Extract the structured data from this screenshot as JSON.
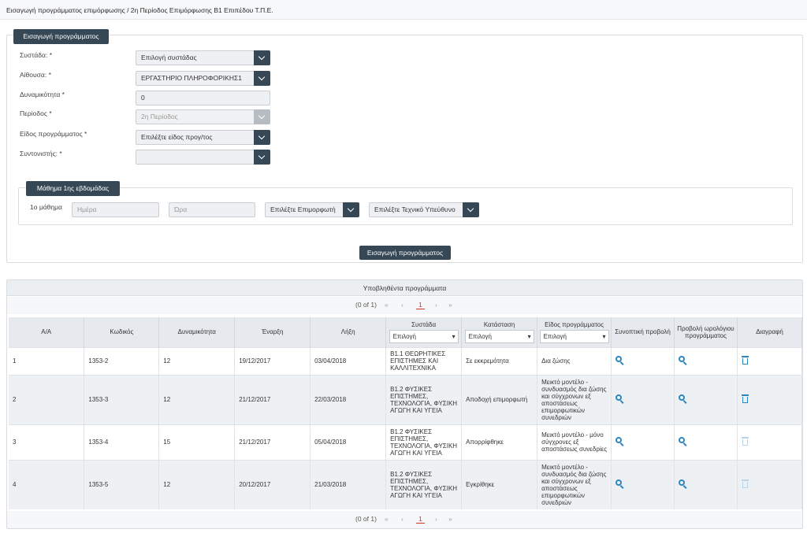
{
  "header": {
    "title": "Εισαγωγή προγράμματος επιμόρφωσης / 2η Περίοδος Επιμόρφωσης Β1 Επιπέδου Τ.Π.Ε."
  },
  "form": {
    "legend": "Εισαγωγή προγράμματος",
    "fields": {
      "systada": {
        "label": "Συστάδα:",
        "value": "Επιλογή συστάδας"
      },
      "aithousa": {
        "label": "Αίθουσα:",
        "value": "ΕΡΓΑΣΤΗΡΙΟ ΠΛΗΡΟΦΟΡΙΚΗΣ1"
      },
      "capacity": {
        "label": "Δυναμικότητα",
        "value": "0"
      },
      "period": {
        "label": "Περίοδος",
        "value": "2η Περίοδος"
      },
      "type": {
        "label": "Είδος προγράμματος",
        "value": "Επιλέξτε είδος προγ/τος"
      },
      "coordinator": {
        "label": "Συντονιστής:",
        "value": ""
      }
    },
    "required_mark": "*",
    "week": {
      "legend": "Μάθημα 1ης εβδομάδας",
      "lesson_label": "1ο μάθημα",
      "day_placeholder": "Ημέρα",
      "time_placeholder": "Ώρα",
      "trainer": "Επιλέξτε Επιμορφωτή",
      "tech": "Επιλέξτε Τεχνικό Υπεύθυνο"
    },
    "submit": "Εισαγωγή προγράμματος"
  },
  "submitted": {
    "title": "Υποβληθέντα προγράμματα",
    "pager": {
      "info": "(0 of 1)",
      "first": "«",
      "prev": "‹",
      "page": "1",
      "next": "›",
      "last": "»"
    },
    "columns": {
      "aa": "Α/Α",
      "code": "Κωδικός",
      "capacity": "Δυναμικότητα",
      "start": "Έναρξη",
      "end": "Λήξη",
      "cluster": "Συστάδα",
      "status": "Κατάσταση",
      "ptype": "Είδος προγράμματος",
      "summary": "Συνοπτική προβολή",
      "schedule": "Προβολή ωρολόγιου προγράμματος",
      "delete": "Διαγραφή"
    },
    "filter_placeholder": "Επιλογή",
    "rows": [
      {
        "aa": "1",
        "code": "1353-2",
        "capacity": "12",
        "start": "19/12/2017",
        "end": "03/04/2018",
        "cluster": "Β1.1 ΘΕΩΡΗΤΙΚΕΣ ΕΠΙΣΤΗΜΕΣ ΚΑΙ ΚΑΛΛΙΤΕΧΝΙΚΑ",
        "status": "Σε εκκρεμότητα",
        "ptype": "Δια ζώσης",
        "deletable": true
      },
      {
        "aa": "2",
        "code": "1353-3",
        "capacity": "12",
        "start": "21/12/2017",
        "end": "22/03/2018",
        "cluster": "Β1.2 ΦΥΣΙΚΕΣ ΕΠΙΣΤΗΜΕΣ, ΤΕΧΝΟΛΟΓΙΑ, ΦΥΣΙΚΗ ΑΓΩΓΗ ΚΑΙ ΥΓΕΙΑ",
        "status": "Αποδοχή επιμορφωτή",
        "ptype": "Μεικτό μοντέλο - συνδυασμός δια ζώσης και σύγχρονων εξ αποστάσεως επιμορφωτικών συνεδριών",
        "deletable": true
      },
      {
        "aa": "3",
        "code": "1353-4",
        "capacity": "15",
        "start": "21/12/2017",
        "end": "05/04/2018",
        "cluster": "Β1.2 ΦΥΣΙΚΕΣ ΕΠΙΣΤΗΜΕΣ, ΤΕΧΝΟΛΟΓΙΑ, ΦΥΣΙΚΗ ΑΓΩΓΗ ΚΑΙ ΥΓΕΙΑ",
        "status": "Απορρίφθηκε",
        "ptype": "Μεικτό μοντέλο - μόνο σύγχρονες εξ αποστάσεως συνεδρίες",
        "deletable": false
      },
      {
        "aa": "4",
        "code": "1353-5",
        "capacity": "12",
        "start": "20/12/2017",
        "end": "21/03/2018",
        "cluster": "Β1.2 ΦΥΣΙΚΕΣ ΕΠΙΣΤΗΜΕΣ, ΤΕΧΝΟΛΟΓΙΑ, ΦΥΣΙΚΗ ΑΓΩΓΗ ΚΑΙ ΥΓΕΙΑ",
        "status": "Εγκρίθηκε",
        "ptype": "Μεικτό μοντέλο - συνδυασμός δια ζώσης και σύγχρονων εξ αποστάσεως επιμορφωτικών συνεδριών",
        "deletable": false
      }
    ]
  },
  "icons": {
    "search": "magnifier-icon",
    "delete": "trash-icon",
    "dropdown": "chevron-down-icon"
  },
  "colors": {
    "dark": "#364856",
    "accent": "#2e86c1",
    "current_page": "#c0392b"
  }
}
